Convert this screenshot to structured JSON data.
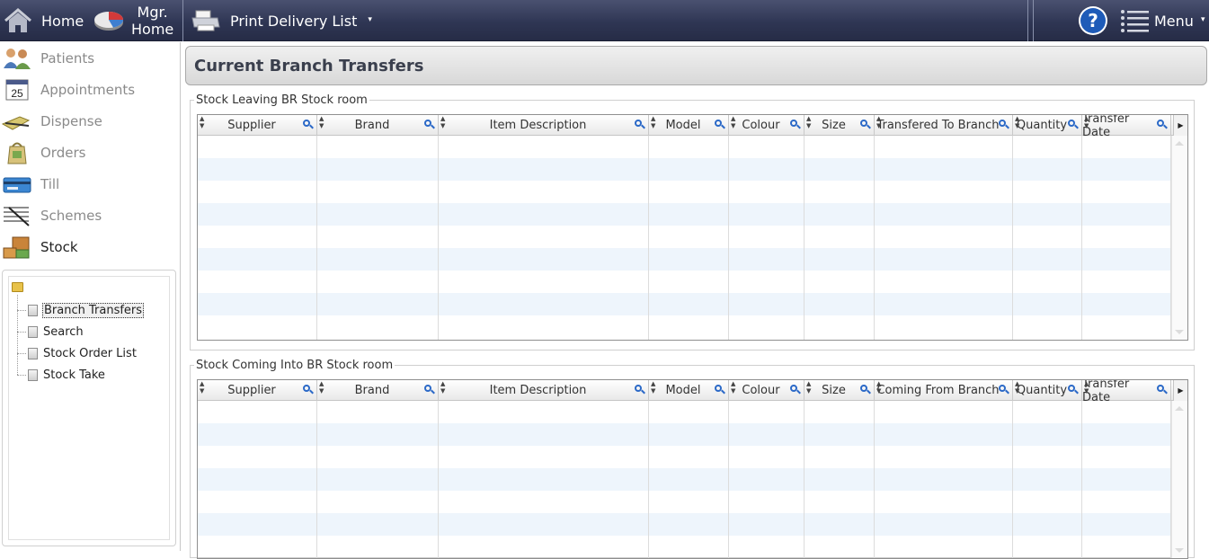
{
  "topbar": {
    "home_label": "Home",
    "mgr_line1": "Mgr.",
    "mgr_line2": "Home",
    "print_label": "Print Delivery List",
    "help_glyph": "?",
    "menu_label": "Menu",
    "caret": "▾",
    "bar_color": "#2f3654"
  },
  "sidebar": {
    "items": [
      {
        "label": "Patients",
        "icon": "patients-icon"
      },
      {
        "label": "Appointments",
        "icon": "calendar-icon",
        "calendar_day": "25"
      },
      {
        "label": "Dispense",
        "icon": "dispense-icon"
      },
      {
        "label": "Orders",
        "icon": "orders-icon"
      },
      {
        "label": "Till",
        "icon": "till-icon"
      },
      {
        "label": "Schemes",
        "icon": "schemes-icon"
      },
      {
        "label": "Stock",
        "icon": "stock-icon",
        "active": true
      }
    ],
    "tree": [
      {
        "label": "Branch Transfers",
        "selected": true
      },
      {
        "label": "Search"
      },
      {
        "label": "Stock Order List"
      },
      {
        "label": "Stock Take"
      }
    ]
  },
  "main": {
    "title": "Current Branch Transfers",
    "leaving": {
      "legend": "Stock Leaving BR Stock room",
      "columns": [
        "Supplier",
        "Brand",
        "Item Description",
        "Model",
        "Colour",
        "Size",
        "Transfered To Branch",
        "Quantity",
        "Transfer Date"
      ]
    },
    "coming": {
      "legend": "Stock Coming Into BR Stock room",
      "columns": [
        "Supplier",
        "Brand",
        "Item Description",
        "Model",
        "Colour",
        "Size",
        "Coming From Branch",
        "Quantity",
        "Transfer Date"
      ]
    },
    "alt_row_color": "#eef5fc",
    "search_icon_color": "#2b69c7"
  }
}
